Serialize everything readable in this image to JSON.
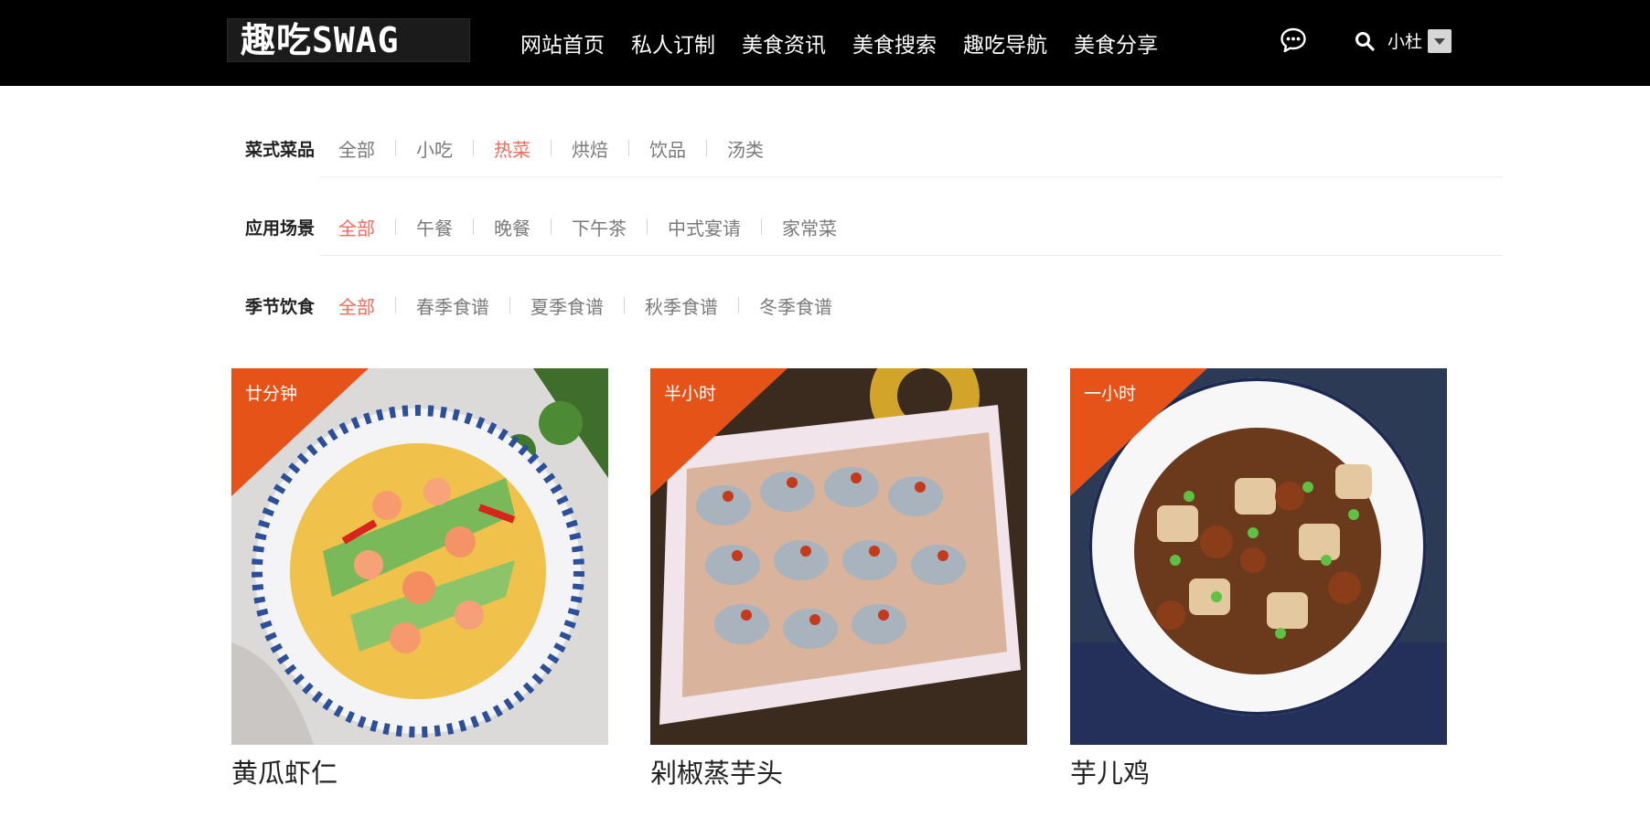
{
  "header": {
    "logo_text": "趣吃SWAG",
    "nav": [
      "网站首页",
      "私人订制",
      "美食资讯",
      "美食搜索",
      "趣吃导航",
      "美食分享"
    ],
    "user_name": "小杜",
    "icons": [
      "chat-icon",
      "search-icon",
      "chevron-down-icon"
    ]
  },
  "filters": [
    {
      "label": "菜式菜品",
      "options": [
        "全部",
        "小吃",
        "热菜",
        "烘焙",
        "饮品",
        "汤类"
      ],
      "active": "热菜"
    },
    {
      "label": "应用场景",
      "options": [
        "全部",
        "午餐",
        "晚餐",
        "下午茶",
        "中式宴请",
        "家常菜"
      ],
      "active": "全部"
    },
    {
      "label": "季节饮食",
      "options": [
        "全部",
        "春季食谱",
        "夏季食谱",
        "秋季食谱",
        "冬季食谱"
      ],
      "active": "全部"
    }
  ],
  "recipes": [
    {
      "time_badge": "廿分钟",
      "title": "黄瓜虾仁"
    },
    {
      "time_badge": "半小时",
      "title": "剁椒蒸芋头"
    },
    {
      "time_badge": "一小时",
      "title": "芋儿鸡"
    }
  ],
  "colors": {
    "topbar": "#000000",
    "active_option": "#f26a5a",
    "badge": "#e55319"
  }
}
